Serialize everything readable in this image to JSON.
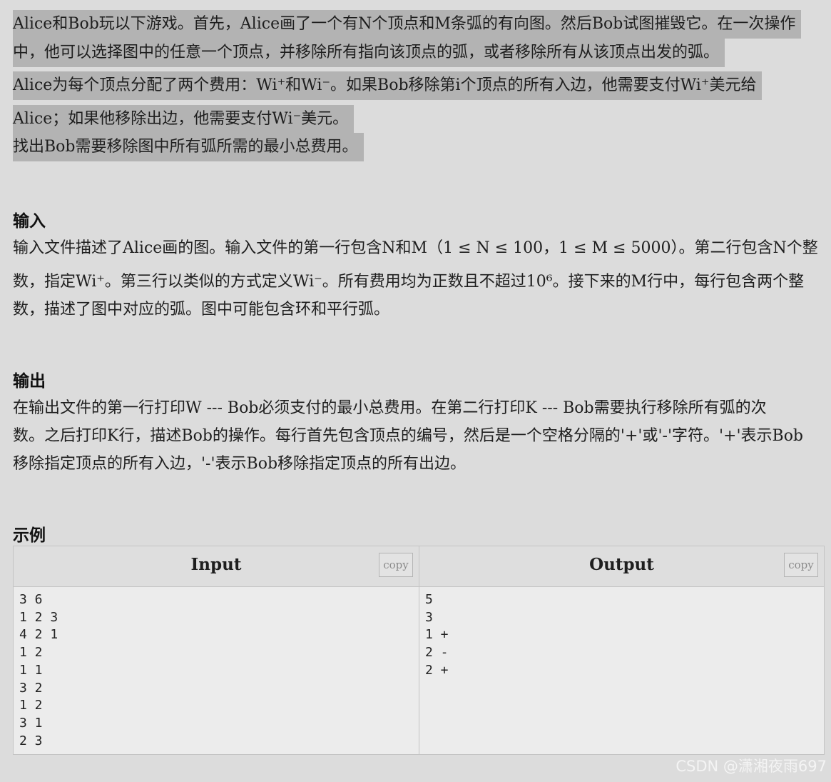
{
  "description": {
    "lines": [
      "Alice和Bob玩以下游戏。首先，Alice画了一个有N个顶点和M条弧的有向图。然后Bob试图摧毁它。在一次操作",
      "中，他可以选择图中的任意一个顶点，并移除所有指向该顶点的弧，或者移除所有从该顶点出发的弧。",
      "Alice为每个顶点分配了两个费用：Wi⁺和Wi⁻。如果Bob移除第i个顶点的所有入边，他需要支付Wi⁺美元给",
      "Alice；如果他移除出边，他需要支付Wi⁻美元。",
      "找出Bob需要移除图中所有弧所需的最小总费用。"
    ]
  },
  "input_section": {
    "heading": "输入",
    "lines": [
      "输入文件描述了Alice画的图。输入文件的第一行包含N和M（1 ≤ N ≤ 100，1 ≤ M ≤ 5000）。第二行包含N个整",
      "数，指定Wi⁺。第三行以类似的方式定义Wi⁻。所有费用均为正数且不超过10⁶。接下来的M行中，每行包含两个整",
      "数，描述了图中对应的弧。图中可能包含环和平行弧。"
    ]
  },
  "output_section": {
    "heading": "输出",
    "lines": [
      "在输出文件的第一行打印W --- Bob必须支付的最小总费用。在第二行打印K --- Bob需要执行移除所有弧的次",
      "数。之后打印K行，描述Bob的操作。每行首先包含顶点的编号，然后是一个空格分隔的'+'或'-'字符。'+'表示Bob",
      "移除指定顶点的所有入边，'-'表示Bob移除指定顶点的所有出边。"
    ]
  },
  "example": {
    "heading": "示例",
    "input_title": "Input",
    "output_title": "Output",
    "copy_label": "copy",
    "input_text": "3 6\n1 2 3\n4 2 1\n1 2\n1 1\n3 2\n1 2\n3 1\n2 3",
    "output_text": "5\n3\n1 +\n2 -\n2 +"
  },
  "watermark": "CSDN @潇湘夜雨697"
}
